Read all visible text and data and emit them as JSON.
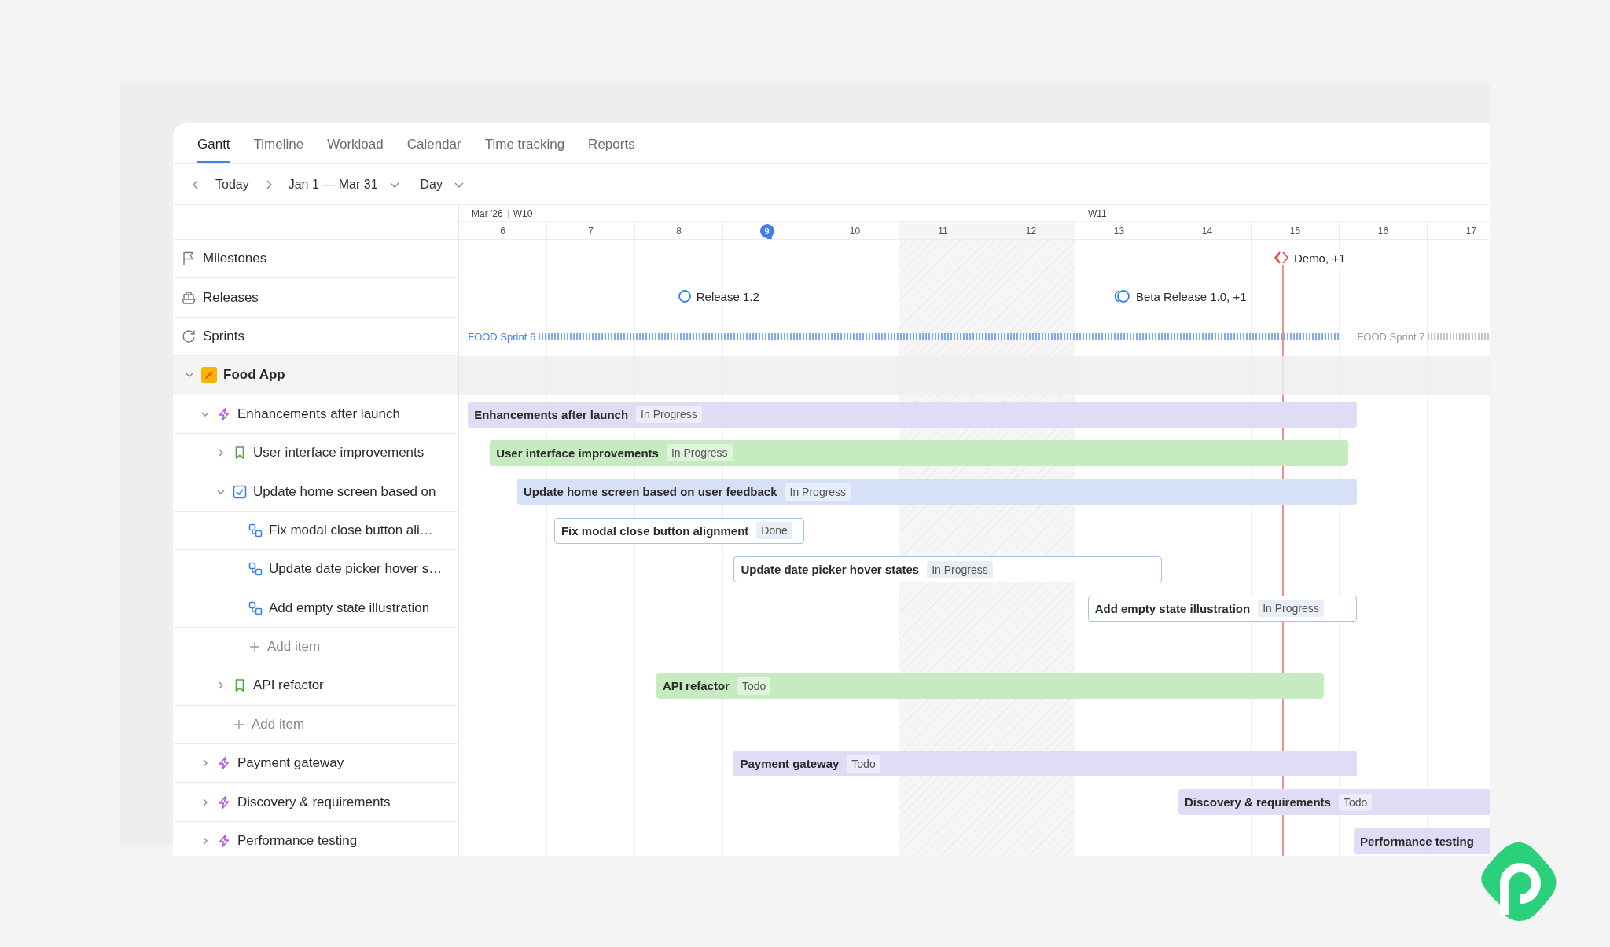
{
  "tabs": [
    {
      "label": "Gantt",
      "selected": true
    },
    {
      "label": "Timeline",
      "selected": false
    },
    {
      "label": "Workload",
      "selected": false
    },
    {
      "label": "Calendar",
      "selected": false
    },
    {
      "label": "Time tracking",
      "selected": false
    },
    {
      "label": "Reports",
      "selected": false
    }
  ],
  "toolbar": {
    "today": "Today",
    "range": "Jan 1 — Mar 31",
    "scale": "Day"
  },
  "timeline_header": {
    "month": "Mar '26",
    "weeks": [
      {
        "label": "W10"
      },
      {
        "label": "W11"
      }
    ],
    "days": [
      {
        "label": "6",
        "today": false,
        "weekend": false
      },
      {
        "label": "7",
        "today": false,
        "weekend": false
      },
      {
        "label": "8",
        "today": false,
        "weekend": false
      },
      {
        "label": "9",
        "today": true,
        "weekend": false
      },
      {
        "label": "10",
        "today": false,
        "weekend": false
      },
      {
        "label": "11",
        "today": false,
        "weekend": true
      },
      {
        "label": "12",
        "today": false,
        "weekend": true
      },
      {
        "label": "13",
        "today": false,
        "weekend": false
      },
      {
        "label": "14",
        "today": false,
        "weekend": false
      },
      {
        "label": "15",
        "today": false,
        "weekend": false
      },
      {
        "label": "16",
        "today": false,
        "weekend": false
      },
      {
        "label": "17",
        "today": false,
        "weekend": false
      }
    ]
  },
  "lanes": [
    {
      "kind": "milestones",
      "label": "Milestones",
      "markers": [
        {
          "kind": "milestone",
          "label": "Demo, +1"
        }
      ]
    },
    {
      "kind": "releases",
      "label": "Releases",
      "markers": [
        {
          "kind": "release",
          "label": "Release 1.2"
        },
        {
          "kind": "release_group",
          "label": "Beta Release 1.0, +1"
        }
      ]
    },
    {
      "kind": "sprints",
      "label": "Sprints",
      "sprints": [
        {
          "label": "FOOD Sprint 6",
          "active": true
        },
        {
          "label": "FOOD Sprint 7",
          "active": false
        }
      ]
    }
  ],
  "project": {
    "name": "Food App",
    "expanded": true,
    "items": [
      {
        "kind": "epic",
        "title": "Enhancements after launch",
        "bar_title": "Enhancements after launch",
        "status": "In Progress",
        "expanded": true,
        "children": [
          {
            "kind": "story",
            "title": "User interface improvements",
            "bar_title": "User interface improvements",
            "status": "In Progress",
            "expanded": false
          },
          {
            "kind": "task",
            "title": "Update home screen based on",
            "bar_title": "Update home screen based on user feedback",
            "status": "In Progress",
            "expanded": true,
            "children": [
              {
                "kind": "subtask",
                "title": "Fix modal close button ali…",
                "bar_title": "Fix modal close button alignment",
                "status": "Done"
              },
              {
                "kind": "subtask",
                "title": "Update date picker hover s…",
                "bar_title": "Update date picker hover states",
                "status": "In Progress"
              },
              {
                "kind": "subtask",
                "title": "Add empty state illustration",
                "bar_title": "Add empty state illustration",
                "status": "In Progress"
              },
              {
                "kind": "add",
                "title": "Add item"
              }
            ]
          },
          {
            "kind": "story",
            "title": "API refactor",
            "bar_title": "API refactor",
            "status": "Todo",
            "expanded": false
          },
          {
            "kind": "add",
            "title": "Add item"
          }
        ]
      },
      {
        "kind": "epic",
        "title": "Payment gateway",
        "bar_title": "Payment gateway",
        "status": "Todo",
        "expanded": false
      },
      {
        "kind": "epic",
        "title": "Discovery & requirements",
        "bar_title": "Discovery & requirements",
        "status": "Todo",
        "expanded": false
      },
      {
        "kind": "epic",
        "title": "Performance testing",
        "bar_title": "Performance testing",
        "expanded": false
      }
    ]
  }
}
